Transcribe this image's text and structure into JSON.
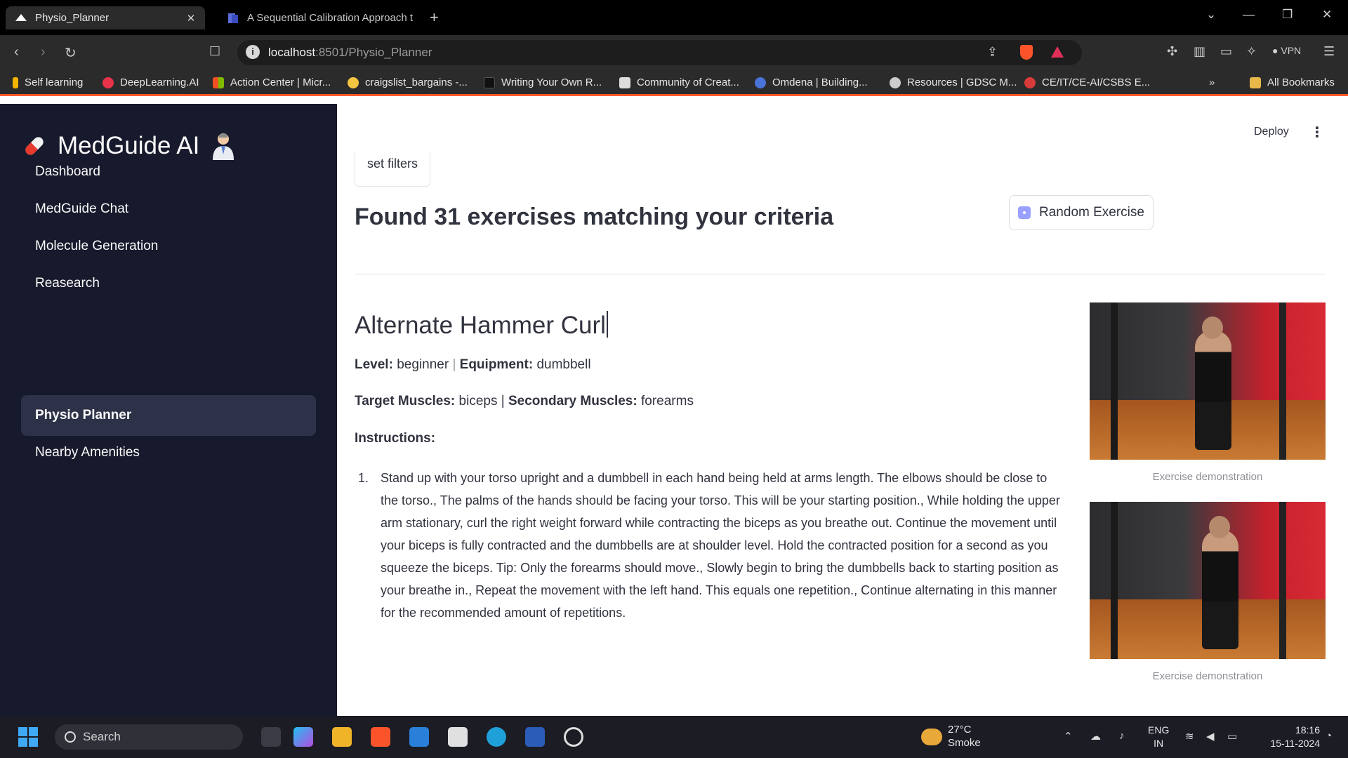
{
  "browser": {
    "tabs": [
      {
        "title": "Physio_Planner",
        "active": true
      },
      {
        "title": "A Sequential Calibration Approach t",
        "active": false
      }
    ],
    "url_host": "localhost",
    "url_path": ":8501/Physio_Planner",
    "vpn_label": "VPN",
    "bookmarks": [
      {
        "label": "Self learning",
        "color": "#f4b400"
      },
      {
        "label": "DeepLearning.AI",
        "color": "#e8334a"
      },
      {
        "label": "Action Center | Micr...",
        "color": "#3b7de8"
      },
      {
        "label": "craigslist_bargains -...",
        "color": "#f4c542"
      },
      {
        "label": "Writing Your Own R...",
        "color": "#111111"
      },
      {
        "label": "Community of Creat...",
        "color": "#dddddd"
      },
      {
        "label": "Omdena | Building...",
        "color": "#4a73d8"
      },
      {
        "label": "Resources | GDSC M...",
        "color": "#cccccc"
      },
      {
        "label": "CE/IT/CE-AI/CSBS E...",
        "color": "#d93b3b"
      }
    ],
    "all_bookmarks": "All Bookmarks"
  },
  "sidebar": {
    "brand": "MedGuide AI",
    "items": [
      {
        "label": "Dashboard",
        "active": false
      },
      {
        "label": "MedGuide Chat",
        "active": false
      },
      {
        "label": "Molecule Generation",
        "active": false
      },
      {
        "label": "Reasearch",
        "active": false
      },
      {
        "label": "Physio Planner",
        "active": true
      },
      {
        "label": "Nearby Amenities",
        "active": false
      }
    ]
  },
  "header": {
    "deploy_label": "Deploy"
  },
  "main": {
    "filters_label": "set filters",
    "found_text": "Found 31 exercises matching your criteria",
    "random_button": "Random Exercise",
    "exercise": {
      "name": "Alternate Hammer Curl",
      "level_label": "Level:",
      "level": "beginner",
      "equipment_label": "Equipment:",
      "equipment": "dumbbell",
      "target_label": "Target Muscles:",
      "target": "biceps",
      "secondary_label": "Secondary Muscles:",
      "secondary": "forearms",
      "separator": "|",
      "instructions_label": "Instructions:",
      "instructions": [
        {
          "num": "1.",
          "text": "Stand up with your torso upright and a dumbbell in each hand being held at arms length. The elbows should be close to the torso., The palms of the hands should be facing your torso. This will be your starting position., While holding the upper arm stationary, curl the right weight forward while contracting the biceps as you breathe out. Continue the movement until your biceps is fully contracted and the dumbbells are at shoulder level. Hold the contracted position for a second as you squeeze the biceps. Tip: Only the forearms should move., Slowly begin to bring the dumbbells back to starting position as your breathe in., Repeat the movement with the left hand. This equals one repetition., Continue alternating in this manner for the recommended amount of repetitions."
        }
      ],
      "image_captions": [
        "Exercise demonstration",
        "Exercise demonstration"
      ]
    }
  },
  "taskbar": {
    "search_label": "Search",
    "temperature": "27°C",
    "weather": "Smoke",
    "lang_top": "ENG",
    "lang_bottom": "IN",
    "time": "18:16",
    "date": "15-11-2024"
  },
  "colors": {
    "sidebar_bg": "#171a2c",
    "sidebar_active": "#2d3248",
    "accent_bar": "#ff5a2a"
  }
}
